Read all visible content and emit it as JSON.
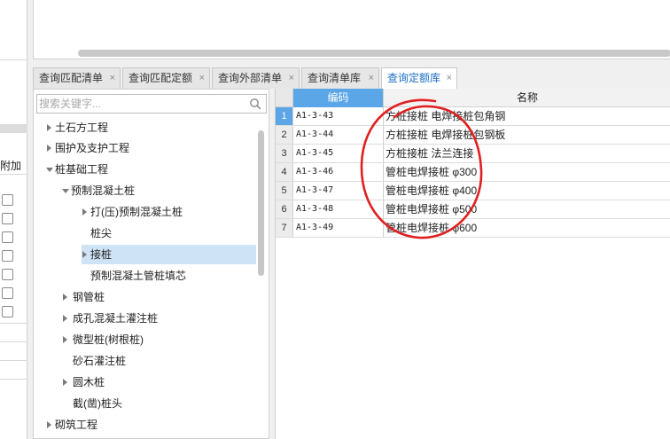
{
  "left_panel": {
    "header_label": "附加"
  },
  "tabs": [
    {
      "label": "查询匹配清单",
      "close": "×",
      "active": false
    },
    {
      "label": "查询匹配定额",
      "close": "×",
      "active": false
    },
    {
      "label": "查询外部清单",
      "close": "×",
      "active": false
    },
    {
      "label": "查询清单库",
      "close": "×",
      "active": false
    },
    {
      "label": "查询定额库",
      "close": "×",
      "active": true
    }
  ],
  "search": {
    "placeholder": "搜索关键字...",
    "value": ""
  },
  "tree": [
    {
      "label": "土石方工程",
      "level": 0,
      "expander": "collapsed"
    },
    {
      "label": "围护及支护工程",
      "level": 0,
      "expander": "collapsed"
    },
    {
      "label": "桩基础工程",
      "level": 0,
      "expander": "expanded"
    },
    {
      "label": "预制混凝土桩",
      "level": 1,
      "expander": "expanded"
    },
    {
      "label": "打(压)预制混凝土桩",
      "level": 2,
      "expander": "collapsed"
    },
    {
      "label": "桩尖",
      "level": 2,
      "expander": "none"
    },
    {
      "label": "接桩",
      "level": 2,
      "expander": "collapsed",
      "selected": true
    },
    {
      "label": "预制混凝土管桩填芯",
      "level": 2,
      "expander": "none"
    },
    {
      "label": "钢管桩",
      "level": 1,
      "expander": "collapsed"
    },
    {
      "label": "成孔混凝土灌注桩",
      "level": 1,
      "expander": "collapsed"
    },
    {
      "label": "微型桩(树根桩)",
      "level": 1,
      "expander": "collapsed"
    },
    {
      "label": "砂石灌注桩",
      "level": 1,
      "expander": "none"
    },
    {
      "label": "圆木桩",
      "level": 1,
      "expander": "collapsed"
    },
    {
      "label": "截(凿)桩头",
      "level": 1,
      "expander": "none"
    },
    {
      "label": "砌筑工程",
      "level": 0,
      "expander": "collapsed"
    }
  ],
  "grid": {
    "columns": {
      "code": "编码",
      "name": "名称"
    },
    "rows": [
      {
        "num": "1",
        "code": "A1-3-43",
        "name": "方桩接桩 电焊接桩包角钢"
      },
      {
        "num": "2",
        "code": "A1-3-44",
        "name": "方桩接桩 电焊接桩包钢板"
      },
      {
        "num": "3",
        "code": "A1-3-45",
        "name": "方桩接桩 法兰连接"
      },
      {
        "num": "4",
        "code": "A1-3-46",
        "name": "管桩电焊接桩 φ300"
      },
      {
        "num": "5",
        "code": "A1-3-47",
        "name": "管桩电焊接桩 φ400"
      },
      {
        "num": "6",
        "code": "A1-3-48",
        "name": "管桩电焊接桩 φ500"
      },
      {
        "num": "7",
        "code": "A1-3-49",
        "name": "管桩电焊接桩 φ600"
      }
    ]
  },
  "colors": {
    "accent": "#5ba6e6",
    "selected_row": "#cfe3f7",
    "annotation": "#e02020",
    "active_tab_text": "#1a6fc6"
  }
}
